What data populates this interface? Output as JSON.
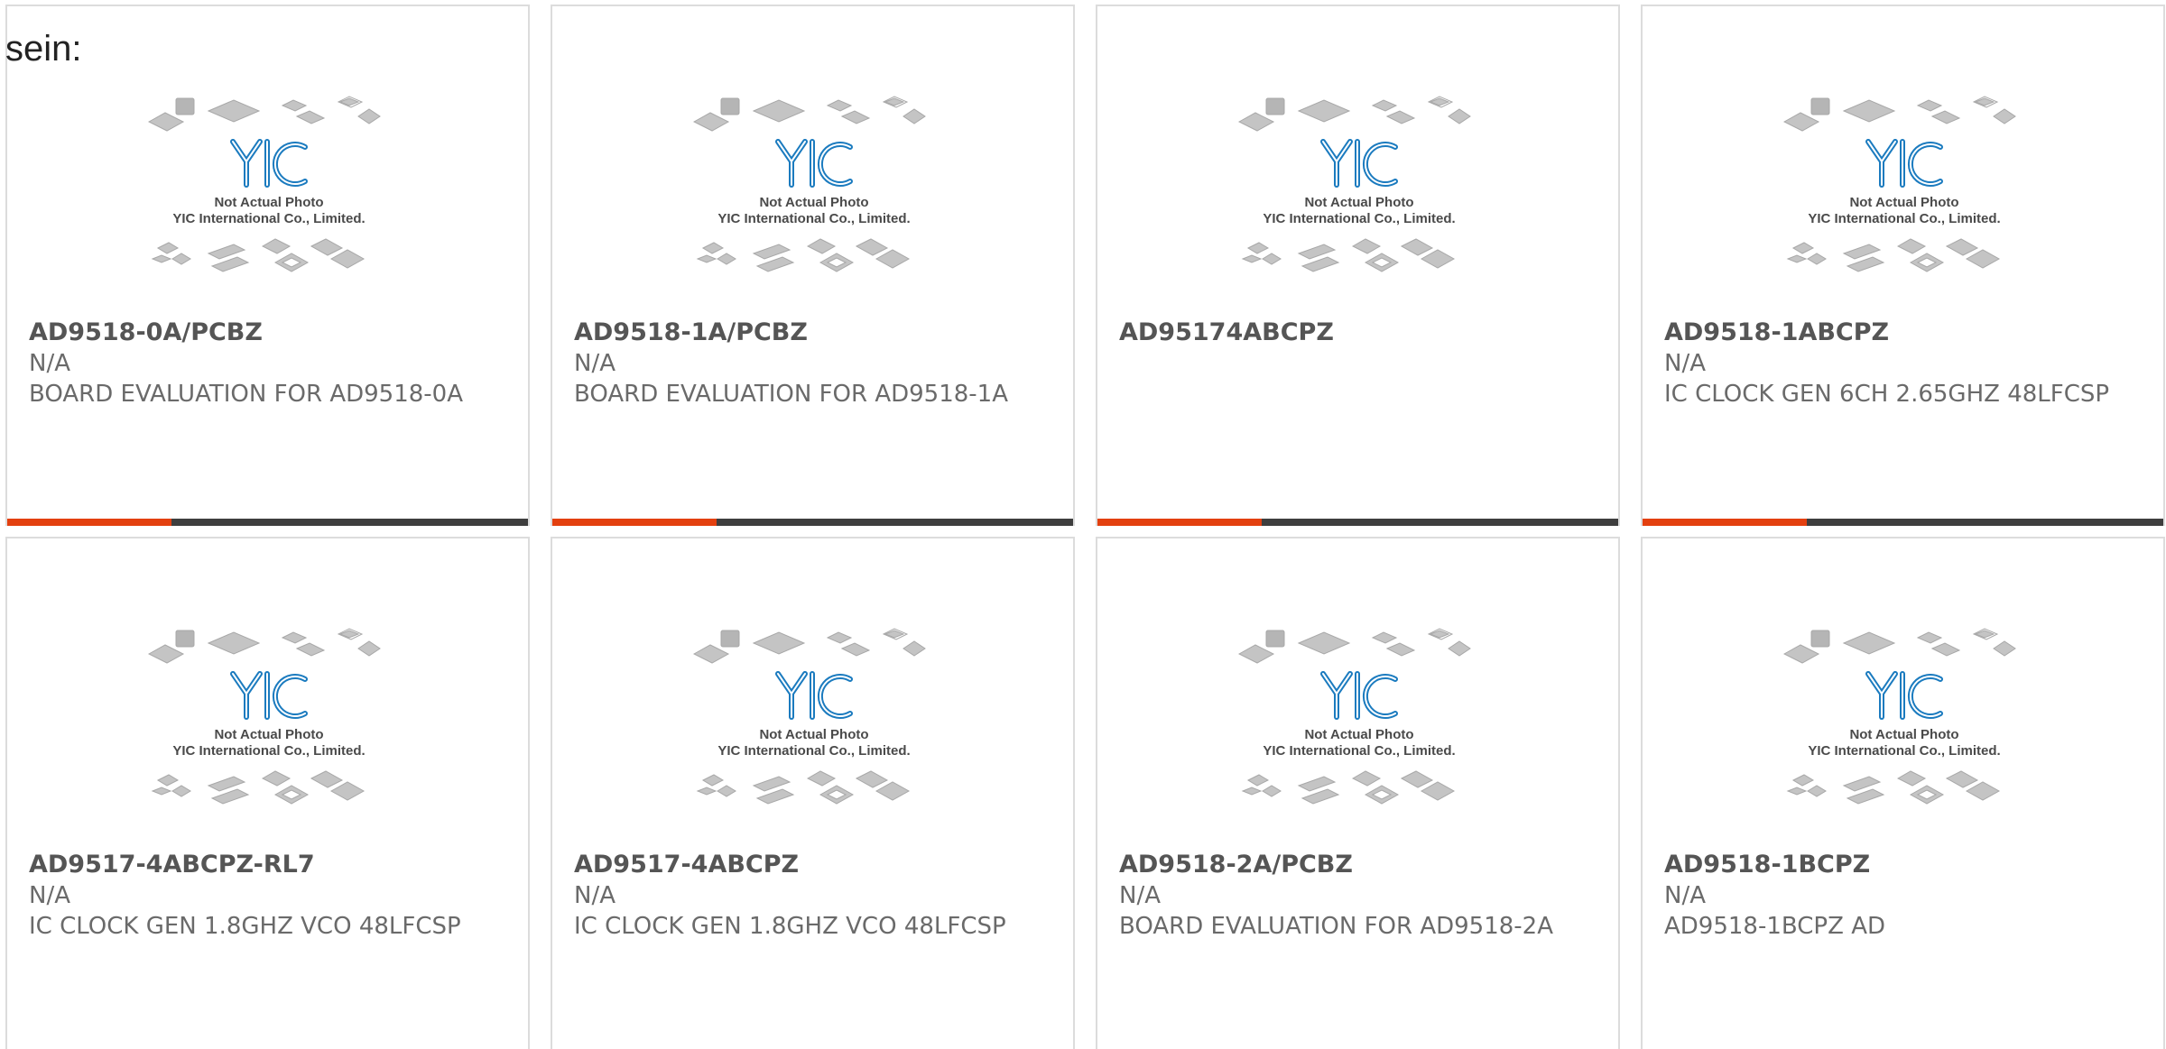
{
  "intro_text": "sein:",
  "thumbnail": {
    "caption_line1": "Not Actual Photo",
    "caption_line2": "YIC International Co., Limited.",
    "logo_text": "YIC"
  },
  "colors": {
    "accent": "#e3400f",
    "bar": "#3e3e3e",
    "logo": "#1b7bbf"
  },
  "products": [
    {
      "part_number": "AD9518-0A/PCBZ",
      "manufacturer": "N/A",
      "description": "BOARD EVALUATION FOR AD9518-0A"
    },
    {
      "part_number": "AD9518-1A/PCBZ",
      "manufacturer": "N/A",
      "description": "BOARD EVALUATION FOR AD9518-1A"
    },
    {
      "part_number": "AD95174ABCPZ",
      "manufacturer": "",
      "description": ""
    },
    {
      "part_number": "AD9518-1ABCPZ",
      "manufacturer": "N/A",
      "description": "IC CLOCK GEN 6CH 2.65GHZ 48LFCSP"
    },
    {
      "part_number": "AD9517-4ABCPZ-RL7",
      "manufacturer": "N/A",
      "description": "IC CLOCK GEN 1.8GHZ VCO 48LFCSP"
    },
    {
      "part_number": "AD9517-4ABCPZ",
      "manufacturer": "N/A",
      "description": "IC CLOCK GEN 1.8GHZ VCO 48LFCSP"
    },
    {
      "part_number": "AD9518-2A/PCBZ",
      "manufacturer": "N/A",
      "description": "BOARD EVALUATION FOR AD9518-2A"
    },
    {
      "part_number": "AD9518-1BCPZ",
      "manufacturer": "N/A",
      "description": "AD9518-1BCPZ AD"
    }
  ]
}
